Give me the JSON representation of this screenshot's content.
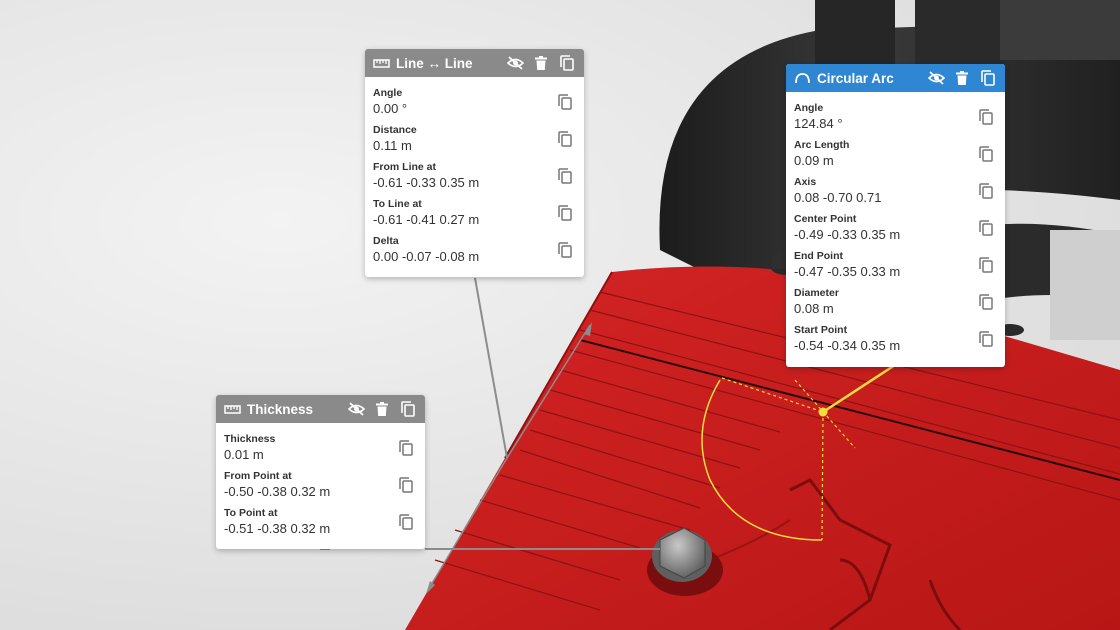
{
  "colors": {
    "accent_blue": "#2f86d3",
    "header_gray": "#8a8a8a",
    "model_red": "#c41e1e",
    "highlight_yellow": "#f5dd3a"
  },
  "line_line": {
    "title": "Line ↔ Line",
    "icon": "ruler-icon",
    "rows": [
      {
        "label": "Angle",
        "value": "0.00 °"
      },
      {
        "label": "Distance",
        "value": "0.11 m"
      },
      {
        "label": "From Line at",
        "value": "-0.61 -0.33 0.35 m"
      },
      {
        "label": "To Line at",
        "value": "-0.61 -0.41 0.27 m"
      },
      {
        "label": "Delta",
        "value": "0.00 -0.07 -0.08 m"
      }
    ]
  },
  "circular_arc": {
    "title": "Circular Arc",
    "icon": "arc-icon",
    "rows": [
      {
        "label": "Angle",
        "value": "124.84 °"
      },
      {
        "label": "Arc Length",
        "value": "0.09 m"
      },
      {
        "label": "Axis",
        "value": "0.08 -0.70 0.71"
      },
      {
        "label": "Center Point",
        "value": "-0.49 -0.33 0.35 m"
      },
      {
        "label": "End Point",
        "value": "-0.47 -0.35 0.33 m"
      },
      {
        "label": "Diameter",
        "value": "0.08 m"
      },
      {
        "label": "Start Point",
        "value": "-0.54 -0.34 0.35 m"
      }
    ]
  },
  "thickness": {
    "title": "Thickness",
    "icon": "ruler-icon",
    "rows": [
      {
        "label": "Thickness",
        "value": "0.01 m"
      },
      {
        "label": "From Point at",
        "value": "-0.50 -0.38 0.32 m"
      },
      {
        "label": "To Point at",
        "value": "-0.51 -0.38 0.32 m"
      }
    ]
  }
}
